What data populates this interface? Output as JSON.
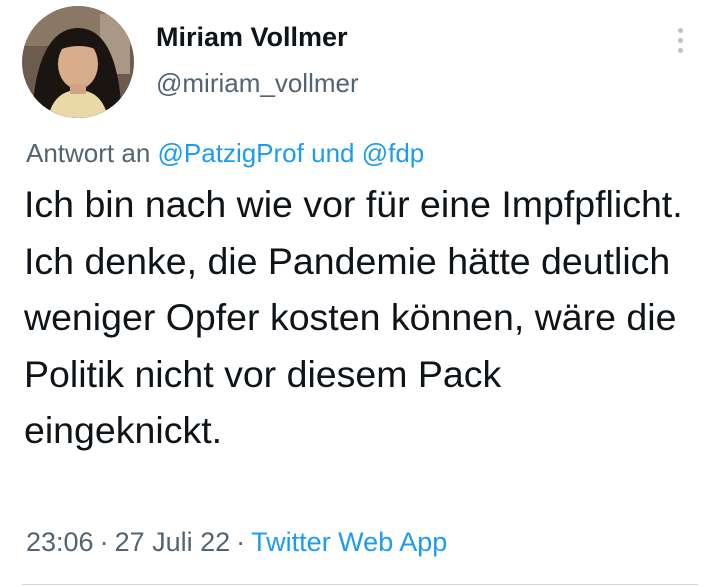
{
  "author": {
    "display_name": "Miriam Vollmer",
    "handle": "@miriam_vollmer"
  },
  "reply_context": {
    "prefix": "Antwort an",
    "mention_1": "@PatzigProf",
    "conjunction": "und",
    "mention_2": "@fdp"
  },
  "tweet": {
    "text": "Ich bin nach wie vor für eine Impfpflicht. Ich denke, die Pandemie hätte deutlich weniger Opfer kosten können, wäre die Politik nicht vor diesem Pack eingeknickt."
  },
  "meta": {
    "time": "23:06",
    "separator": "·",
    "date": "27 Juli 22",
    "source": "Twitter Web App"
  },
  "icons": {
    "more": "more-vertical-icon"
  },
  "colors": {
    "text": "#0f1419",
    "secondary": "#536471",
    "link": "#1d9bf0",
    "divider": "#cfd9de"
  }
}
